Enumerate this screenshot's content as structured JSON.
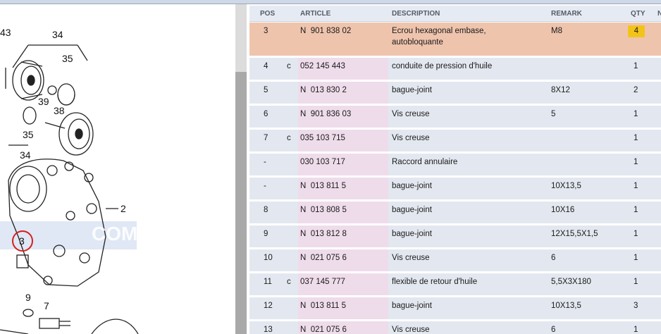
{
  "diagram": {
    "callouts": [
      "43",
      "34",
      "35",
      "39",
      "38",
      "35",
      "34",
      "2",
      "3",
      "9",
      "7"
    ],
    "watermark": "COM",
    "highlight_color": "#d42020"
  },
  "table": {
    "headers": {
      "pos": "POS",
      "article": "ARTICLE",
      "description": "DESCRIPTION",
      "remark": "REMARK",
      "qty": "QTY",
      "extra": "N"
    },
    "rows": [
      {
        "pos": "3",
        "flag": "",
        "article": "N  901 838 02",
        "description": "Ecrou hexagonal embase, autobloquante",
        "remark": "M8",
        "qty": "4",
        "selected": true
      },
      {
        "pos": "4",
        "flag": "c",
        "article": "052 145 443",
        "description": "conduite de pression d'huile",
        "remark": "",
        "qty": "1"
      },
      {
        "pos": "5",
        "flag": "",
        "article": "N  013 830 2",
        "description": "bague-joint",
        "remark": "8X12",
        "qty": "2"
      },
      {
        "pos": "6",
        "flag": "",
        "article": "N  901 836 03",
        "description": "Vis creuse",
        "remark": "5",
        "qty": "1"
      },
      {
        "pos": "7",
        "flag": "c",
        "article": "035 103 715",
        "description": "Vis creuse",
        "remark": "",
        "qty": "1"
      },
      {
        "pos": "-",
        "flag": "",
        "article": "030 103 717",
        "description": "Raccord annulaire",
        "remark": "",
        "qty": "1"
      },
      {
        "pos": "-",
        "flag": "",
        "article": "N  013 811 5",
        "description": "bague-joint",
        "remark": "10X13,5",
        "qty": "1"
      },
      {
        "pos": "8",
        "flag": "",
        "article": "N  013 808 5",
        "description": "bague-joint",
        "remark": "10X16",
        "qty": "1"
      },
      {
        "pos": "9",
        "flag": "",
        "article": "N  013 812 8",
        "description": "bague-joint",
        "remark": "12X15,5X1,5",
        "qty": "1"
      },
      {
        "pos": "10",
        "flag": "",
        "article": "N  021 075 6",
        "description": "Vis creuse",
        "remark": "6",
        "qty": "1"
      },
      {
        "pos": "11",
        "flag": "c",
        "article": "037 145 777",
        "description": "flexible de retour d'huile",
        "remark": "5,5X3X180",
        "qty": "1"
      },
      {
        "pos": "12",
        "flag": "",
        "article": "N  013 811 5",
        "description": "bague-joint",
        "remark": "10X13,5",
        "qty": "3"
      },
      {
        "pos": "13",
        "flag": "",
        "article": "N  021 075 6",
        "description": "Vis creuse",
        "remark": "6",
        "qty": "1"
      }
    ]
  },
  "colors": {
    "selected_row": "#efc4ad",
    "row": "#e3e8f0",
    "article_col": "#efdceb",
    "qty_badge": "#f2c41a"
  }
}
